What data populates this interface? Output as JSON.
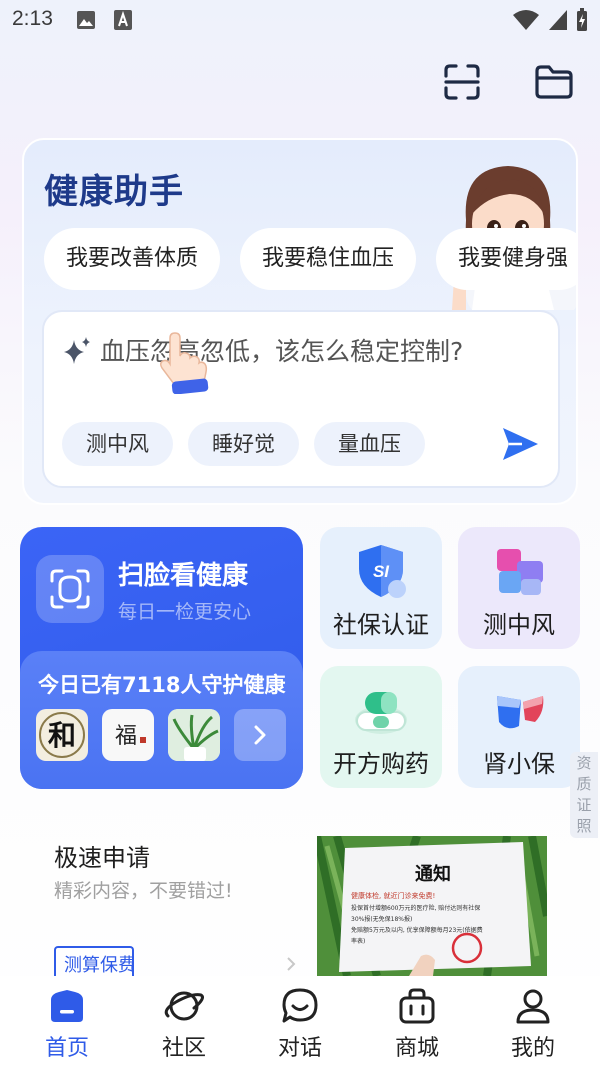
{
  "status_bar": {
    "time": "2:13"
  },
  "assistant": {
    "title": "健康助手",
    "goals": [
      "我要改善体质",
      "我要稳住血压",
      "我要健身强"
    ],
    "query_text": "血压忽高忽低，该怎么稳定控制?",
    "suggestions": [
      "测中风",
      "睡好觉",
      "量血压"
    ]
  },
  "scan": {
    "title": "扫脸看健康",
    "subtitle": "每日一检更安心",
    "guard_text": "今日已有7118人守护健康",
    "thumb1_text": "和",
    "thumb2_text": "福"
  },
  "features": [
    {
      "label": "社保认证",
      "icon_text": "SI"
    },
    {
      "label": "测中风"
    },
    {
      "label": "开方购药"
    },
    {
      "label": "肾小保"
    }
  ],
  "side_tag": "资质证照",
  "promo": {
    "title": "极速申请",
    "subtitle": "精彩内容，不要错过!",
    "button_label": "测算保费",
    "notice_title": "通知",
    "notice_lines": [
      "健康体检, 就近门诊来免费!",
      "投保首付增额600万元的医疗险, 赔付达则有社保",
      "30%报(无免保18%报)",
      "免赔额5万元及以内, 优享保障额每月23元(依据费",
      "率表)"
    ]
  },
  "nav": [
    {
      "label": "首页"
    },
    {
      "label": "社区"
    },
    {
      "label": "对话"
    },
    {
      "label": "商城"
    },
    {
      "label": "我的"
    }
  ],
  "colors": {
    "primary": "#2f5be8",
    "title_blue": "#1e3a8a"
  },
  "icons": [
    "photo-icon",
    "font-icon",
    "wifi-icon",
    "signal-icon",
    "battery-icon",
    "scan-icon",
    "folder-icon",
    "sparkle-icon",
    "hand-pointer-icon",
    "send-icon",
    "face-scan-icon",
    "chevron-right-icon",
    "social-security-icon",
    "stroke-check-icon",
    "prescription-icon",
    "kidney-icon",
    "home-icon",
    "community-planet-icon",
    "chat-icon",
    "shop-icon",
    "profile-icon"
  ]
}
